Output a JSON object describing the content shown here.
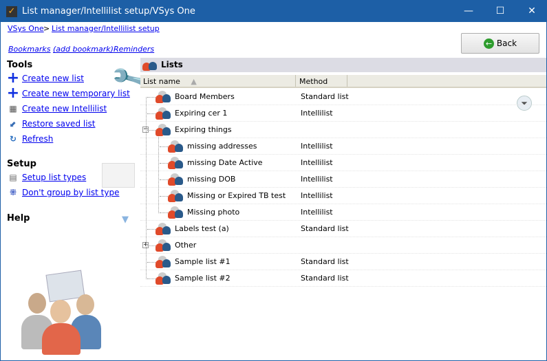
{
  "window": {
    "title": "List manager/Intellilist setup/VSys One"
  },
  "breadcrumb": {
    "root": "VSys One",
    "sep": ">",
    "current": "List manager/Intellilist setup"
  },
  "links": {
    "bookmarks": "Bookmarks",
    "add_bookmark": "(add bookmark)",
    "reminders": "Reminders"
  },
  "back_label": "Back",
  "tools": {
    "title": "Tools",
    "items": [
      "Create new list",
      "Create new temporary list",
      "Create new Intellilist",
      "Restore saved list",
      "Refresh"
    ]
  },
  "setup": {
    "title": "Setup",
    "items": [
      "Setup list types",
      "Don't group by list type"
    ]
  },
  "help": {
    "title": "Help"
  },
  "lists": {
    "title": "Lists",
    "col_name": "List name",
    "col_method": "Method",
    "rows": [
      {
        "name": "Board Members",
        "method": "Standard list"
      },
      {
        "name": "Expiring cer 1",
        "method": "Intellilist"
      },
      {
        "name": "Expiring things",
        "method": ""
      },
      {
        "name": "missing addresses",
        "method": "Intellilist"
      },
      {
        "name": "missing Date Active",
        "method": "Intellilist"
      },
      {
        "name": "missing DOB",
        "method": "Intellilist"
      },
      {
        "name": "Missing or Expired TB test",
        "method": "Intellilist"
      },
      {
        "name": "Missing photo",
        "method": "Intellilist"
      },
      {
        "name": "Labels test (a)",
        "method": "Standard list"
      },
      {
        "name": "Other",
        "method": ""
      },
      {
        "name": "Sample list #1",
        "method": "Standard list"
      },
      {
        "name": "Sample list #2",
        "method": "Standard list"
      }
    ]
  }
}
